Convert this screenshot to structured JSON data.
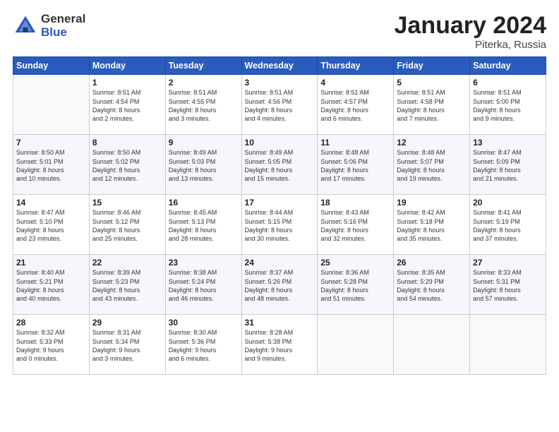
{
  "logo": {
    "general": "General",
    "blue": "Blue"
  },
  "title": {
    "month": "January 2024",
    "location": "Piterka, Russia"
  },
  "headers": [
    "Sunday",
    "Monday",
    "Tuesday",
    "Wednesday",
    "Thursday",
    "Friday",
    "Saturday"
  ],
  "weeks": [
    [
      {
        "day": "",
        "info": ""
      },
      {
        "day": "1",
        "info": "Sunrise: 8:51 AM\nSunset: 4:54 PM\nDaylight: 8 hours\nand 2 minutes."
      },
      {
        "day": "2",
        "info": "Sunrise: 8:51 AM\nSunset: 4:55 PM\nDaylight: 8 hours\nand 3 minutes."
      },
      {
        "day": "3",
        "info": "Sunrise: 8:51 AM\nSunset: 4:56 PM\nDaylight: 8 hours\nand 4 minutes."
      },
      {
        "day": "4",
        "info": "Sunrise: 8:51 AM\nSunset: 4:57 PM\nDaylight: 8 hours\nand 6 minutes."
      },
      {
        "day": "5",
        "info": "Sunrise: 8:51 AM\nSunset: 4:58 PM\nDaylight: 8 hours\nand 7 minutes."
      },
      {
        "day": "6",
        "info": "Sunrise: 8:51 AM\nSunset: 5:00 PM\nDaylight: 8 hours\nand 9 minutes."
      }
    ],
    [
      {
        "day": "7",
        "info": "Sunrise: 8:50 AM\nSunset: 5:01 PM\nDaylight: 8 hours\nand 10 minutes."
      },
      {
        "day": "8",
        "info": "Sunrise: 8:50 AM\nSunset: 5:02 PM\nDaylight: 8 hours\nand 12 minutes."
      },
      {
        "day": "9",
        "info": "Sunrise: 8:49 AM\nSunset: 5:03 PM\nDaylight: 8 hours\nand 13 minutes."
      },
      {
        "day": "10",
        "info": "Sunrise: 8:49 AM\nSunset: 5:05 PM\nDaylight: 8 hours\nand 15 minutes."
      },
      {
        "day": "11",
        "info": "Sunrise: 8:48 AM\nSunset: 5:06 PM\nDaylight: 8 hours\nand 17 minutes."
      },
      {
        "day": "12",
        "info": "Sunrise: 8:48 AM\nSunset: 5:07 PM\nDaylight: 8 hours\nand 19 minutes."
      },
      {
        "day": "13",
        "info": "Sunrise: 8:47 AM\nSunset: 5:09 PM\nDaylight: 8 hours\nand 21 minutes."
      }
    ],
    [
      {
        "day": "14",
        "info": "Sunrise: 8:47 AM\nSunset: 5:10 PM\nDaylight: 8 hours\nand 23 minutes."
      },
      {
        "day": "15",
        "info": "Sunrise: 8:46 AM\nSunset: 5:12 PM\nDaylight: 8 hours\nand 25 minutes."
      },
      {
        "day": "16",
        "info": "Sunrise: 8:45 AM\nSunset: 5:13 PM\nDaylight: 8 hours\nand 28 minutes."
      },
      {
        "day": "17",
        "info": "Sunrise: 8:44 AM\nSunset: 5:15 PM\nDaylight: 8 hours\nand 30 minutes."
      },
      {
        "day": "18",
        "info": "Sunrise: 8:43 AM\nSunset: 5:16 PM\nDaylight: 8 hours\nand 32 minutes."
      },
      {
        "day": "19",
        "info": "Sunrise: 8:42 AM\nSunset: 5:18 PM\nDaylight: 8 hours\nand 35 minutes."
      },
      {
        "day": "20",
        "info": "Sunrise: 8:41 AM\nSunset: 5:19 PM\nDaylight: 8 hours\nand 37 minutes."
      }
    ],
    [
      {
        "day": "21",
        "info": "Sunrise: 8:40 AM\nSunset: 5:21 PM\nDaylight: 8 hours\nand 40 minutes."
      },
      {
        "day": "22",
        "info": "Sunrise: 8:39 AM\nSunset: 5:23 PM\nDaylight: 8 hours\nand 43 minutes."
      },
      {
        "day": "23",
        "info": "Sunrise: 8:38 AM\nSunset: 5:24 PM\nDaylight: 8 hours\nand 46 minutes."
      },
      {
        "day": "24",
        "info": "Sunrise: 8:37 AM\nSunset: 5:26 PM\nDaylight: 8 hours\nand 48 minutes."
      },
      {
        "day": "25",
        "info": "Sunrise: 8:36 AM\nSunset: 5:28 PM\nDaylight: 8 hours\nand 51 minutes."
      },
      {
        "day": "26",
        "info": "Sunrise: 8:35 AM\nSunset: 5:29 PM\nDaylight: 8 hours\nand 54 minutes."
      },
      {
        "day": "27",
        "info": "Sunrise: 8:33 AM\nSunset: 5:31 PM\nDaylight: 8 hours\nand 57 minutes."
      }
    ],
    [
      {
        "day": "28",
        "info": "Sunrise: 8:32 AM\nSunset: 5:33 PM\nDaylight: 9 hours\nand 0 minutes."
      },
      {
        "day": "29",
        "info": "Sunrise: 8:31 AM\nSunset: 5:34 PM\nDaylight: 9 hours\nand 3 minutes."
      },
      {
        "day": "30",
        "info": "Sunrise: 8:30 AM\nSunset: 5:36 PM\nDaylight: 9 hours\nand 6 minutes."
      },
      {
        "day": "31",
        "info": "Sunrise: 8:28 AM\nSunset: 5:38 PM\nDaylight: 9 hours\nand 9 minutes."
      },
      {
        "day": "",
        "info": ""
      },
      {
        "day": "",
        "info": ""
      },
      {
        "day": "",
        "info": ""
      }
    ]
  ]
}
